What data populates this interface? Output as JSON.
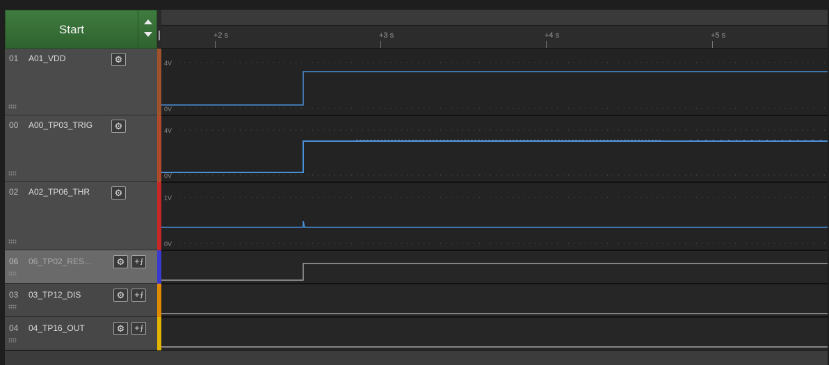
{
  "toolbar": {
    "start_label": "Start"
  },
  "ruler": {
    "ticks": [
      "+2 s",
      "+3 s",
      "+4 s",
      "+5 s"
    ]
  },
  "channels": [
    {
      "num": "01",
      "name": "A01_VDD",
      "color": "#a0522d",
      "type": "analog",
      "y_top": "4V",
      "y_bottom": "0V"
    },
    {
      "num": "00",
      "name": "A00_TP03_TRIG",
      "color": "#b04a2a",
      "type": "analog",
      "y_top": "4V",
      "y_bottom": "0V"
    },
    {
      "num": "02",
      "name": "A02_TP06_THR",
      "color": "#c62828",
      "type": "analog",
      "y_top": "1V",
      "y_bottom": "0V"
    },
    {
      "num": "06",
      "name": "06_TP02_RES...",
      "color": "#3a3ad0",
      "type": "digital"
    },
    {
      "num": "03",
      "name": "03_TP12_DIS",
      "color": "#e08a00",
      "type": "digital"
    },
    {
      "num": "04",
      "name": "04_TP16_OUT",
      "color": "#e0b400",
      "type": "digital"
    }
  ],
  "colors": {
    "trace_analog": "#4a90d9",
    "trace_digital": "#bdbdbd",
    "start_green": "#3a733a"
  }
}
